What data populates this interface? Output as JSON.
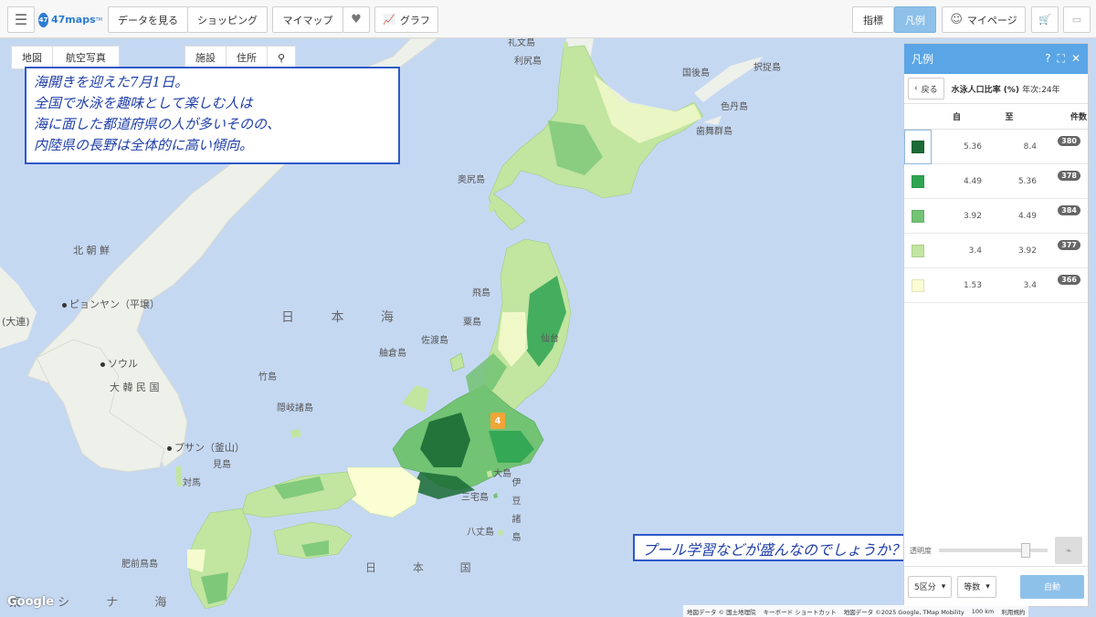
{
  "toolbar": {
    "logo_mark": "47",
    "logo": "47maps",
    "logo_tm": "TM",
    "view_data": "データを見る",
    "shopping": "ショッピング",
    "mymap": "マイマップ",
    "graph": "グラフ",
    "indicator": "指標",
    "legend": "凡例",
    "mypage": "マイページ"
  },
  "map_tabs": {
    "map": "地図",
    "aerial": "航空写真",
    "facility": "施設",
    "address": "住所"
  },
  "map_labels": {
    "rebun": "礼文島",
    "rishiri": "利尻島",
    "kunashiri": "国後島",
    "etorofu": "択捉島",
    "shikotan": "色丹島",
    "habomai": "歯舞群島",
    "okushiri": "奥尻島",
    "north_korea": "北 朝 鮮",
    "pyongyang": "ピョンヤン（平壌）",
    "dalian": "(大連)",
    "seoul": "ソウル",
    "south_korea": "大 韓 民 国",
    "busan": "プサン（釜山）",
    "tsushima": "対馬",
    "iki": "見島",
    "sea_of_japan": "日 本 海",
    "tobi": "飛島",
    "awa": "粟島",
    "sado": "佐渡島",
    "sendai": "仙台",
    "fugeshi": "舳倉島",
    "take": "竹島",
    "oki": "隠岐諸島",
    "oshima": "大島",
    "miyake": "三宅島",
    "izu": "伊豆諸島",
    "hachijo": "八丈島",
    "hizen": "肥前鳥島",
    "japan": "日 本 国",
    "east_china_sea": "東 シ ナ 海"
  },
  "note1": {
    "line1": "海開きを迎えた7月1日。",
    "line2": "全国で水泳を趣味として楽しむ人は",
    "line3": "海に面した都道府県の人が多いそのの、",
    "line4": "内陸県の長野は全体的に高い傾向。"
  },
  "note2": "プール学習などが盛んなのでしょうか？？",
  "legend_panel": {
    "title": "凡例",
    "back": "戻る",
    "indicator_name": "水泳人口比率 (%)",
    "year": "年次:24年",
    "col_from": "自",
    "col_to": "至",
    "col_count": "件数",
    "rows": [
      {
        "from": "5.36",
        "to": "8.4",
        "count": "380",
        "color": "#1a6b35"
      },
      {
        "from": "4.49",
        "to": "5.36",
        "count": "378",
        "color": "#2fa552"
      },
      {
        "from": "3.92",
        "to": "4.49",
        "count": "384",
        "color": "#72c373"
      },
      {
        "from": "3.4",
        "to": "3.92",
        "count": "377",
        "color": "#c2e5a0"
      },
      {
        "from": "1.53",
        "to": "3.4",
        "count": "366",
        "color": "#fbfdd2"
      }
    ],
    "opacity_label": "透明度",
    "classes": "5区分",
    "method": "等数",
    "auto": "自動"
  },
  "pin_label": "4",
  "attribution": {
    "data1": "地図データ © 国土地理院",
    "shortcuts": "キーボード ショートカット",
    "data2": "地図データ ©2025 Google, TMap Mobility",
    "scale": "100 km",
    "terms": "利用規約"
  },
  "google": "Google"
}
